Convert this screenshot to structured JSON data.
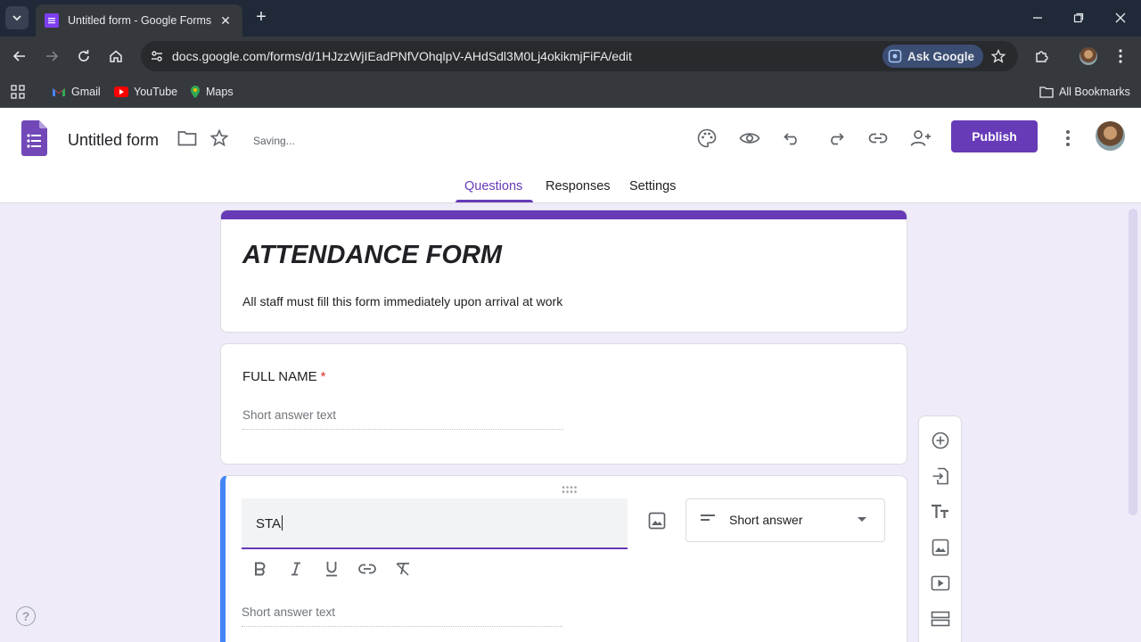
{
  "browser": {
    "tab_title": "Untitled form - Google Forms",
    "url": "docs.google.com/forms/d/1HJzzWjIEadPNfVOhqlpV-AHdSdl3M0Lj4okikmjFiFA/edit",
    "ask_google_label": "Ask Google",
    "bookmarks": [
      {
        "label": "Gmail",
        "icon": "gmail-icon"
      },
      {
        "label": "YouTube",
        "icon": "youtube-icon"
      },
      {
        "label": "Maps",
        "icon": "maps-icon"
      }
    ],
    "all_bookmarks_label": "All Bookmarks"
  },
  "header": {
    "form_title": "Untitled form",
    "status": "Saving...",
    "publish_label": "Publish",
    "tabs": [
      "Questions",
      "Responses",
      "Settings"
    ],
    "active_tab": "Questions",
    "accent_color": "#673ab7"
  },
  "form": {
    "title": "ATTENDANCE FORM",
    "description": "All staff must fill this form immediately upon arrival at work",
    "questions": [
      {
        "label": "FULL NAME",
        "required_mark": "*",
        "placeholder": "Short answer text"
      },
      {
        "value": "STA",
        "type": "Short answer",
        "placeholder": "Short answer text"
      }
    ]
  },
  "help_label": "?"
}
